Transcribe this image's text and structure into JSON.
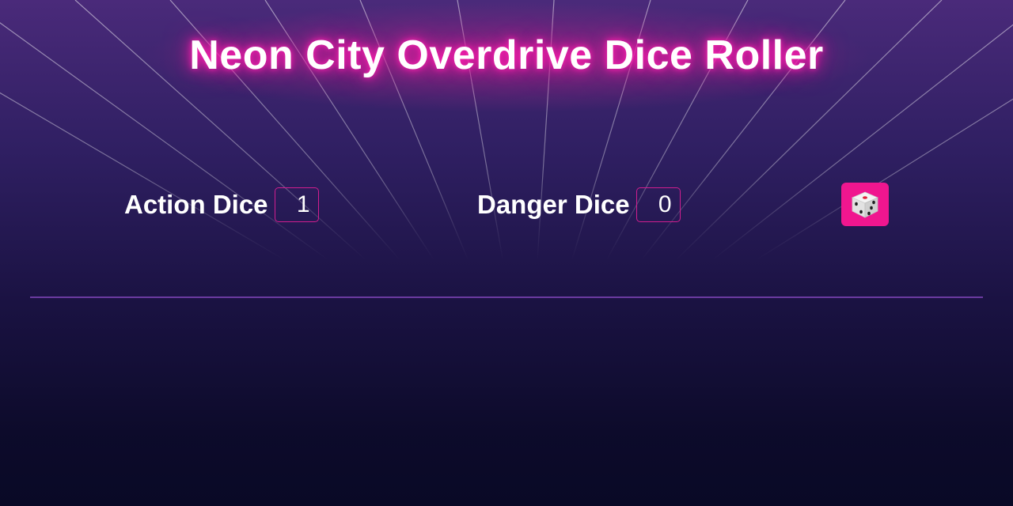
{
  "app": {
    "title": "Neon City Overdrive Dice Roller"
  },
  "controls": {
    "action_dice": {
      "label": "Action Dice",
      "value": "1"
    },
    "danger_dice": {
      "label": "Danger Dice",
      "value": "0"
    },
    "roll_button": {
      "icon": "dice-icon"
    }
  },
  "theme": {
    "accent": "#f0168f",
    "glow": "#ff1fb0",
    "divider": "#6b3aa0"
  }
}
